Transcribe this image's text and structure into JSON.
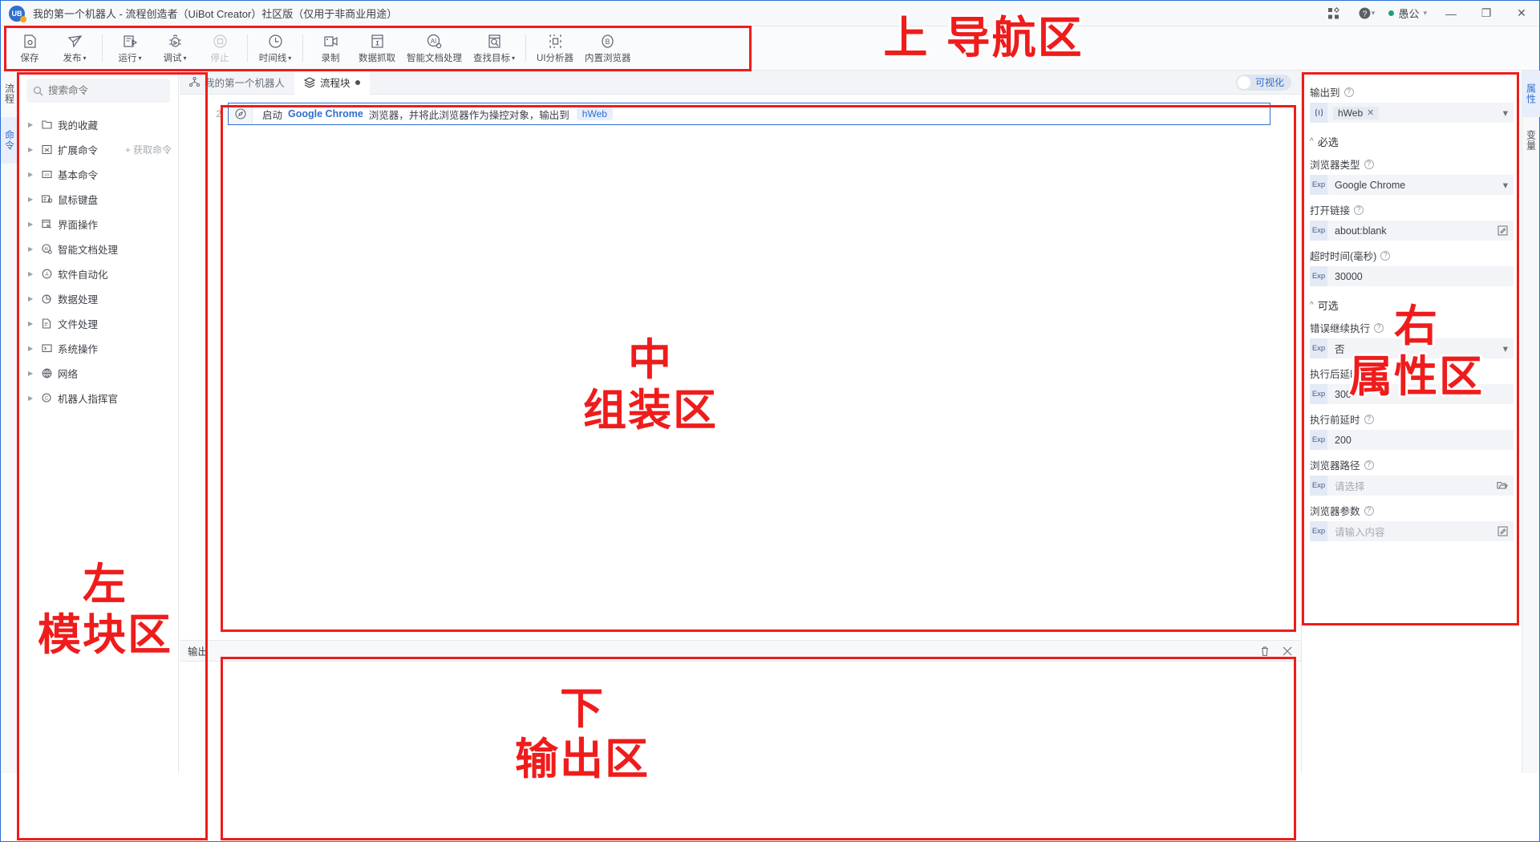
{
  "window": {
    "title": "我的第一个机器人 - 流程创造者（UiBot Creator）社区版（仅用于非商业用途）",
    "user": "愚公",
    "minimize": "—",
    "restore": "❐",
    "close": "✕"
  },
  "toolbar": {
    "groups": [
      {
        "items": [
          {
            "label": "保存",
            "icon": "save-icon",
            "caret": false,
            "disabled": false
          },
          {
            "label": "发布",
            "icon": "publish-icon",
            "caret": true,
            "disabled": false
          }
        ]
      },
      {
        "items": [
          {
            "label": "运行",
            "icon": "run-icon",
            "caret": true,
            "disabled": false
          },
          {
            "label": "调试",
            "icon": "debug-icon",
            "caret": true,
            "disabled": false
          },
          {
            "label": "停止",
            "icon": "stop-icon",
            "caret": false,
            "disabled": true
          }
        ]
      },
      {
        "items": [
          {
            "label": "时间线",
            "icon": "timeline-icon",
            "caret": true,
            "disabled": false
          }
        ]
      },
      {
        "items": [
          {
            "label": "录制",
            "icon": "record-icon",
            "caret": false,
            "disabled": false
          },
          {
            "label": "数据抓取",
            "icon": "data-scrape-icon",
            "caret": false,
            "disabled": false
          },
          {
            "label": "智能文档处理",
            "icon": "ai-doc-icon",
            "caret": false,
            "disabled": false
          },
          {
            "label": "查找目标",
            "icon": "find-target-icon",
            "caret": true,
            "disabled": false
          }
        ]
      },
      {
        "items": [
          {
            "label": "UI分析器",
            "icon": "ui-analyzer-icon",
            "caret": false,
            "disabled": false
          },
          {
            "label": "内置浏览器",
            "icon": "builtin-browser-icon",
            "caret": false,
            "disabled": false
          }
        ]
      }
    ]
  },
  "left_rail": {
    "tabs": [
      {
        "label": "流程",
        "active": false
      },
      {
        "label": "命令",
        "active": true
      }
    ]
  },
  "left_panel": {
    "search": {
      "placeholder": "搜索命令",
      "value": "",
      "icon": "search-icon"
    },
    "get_command": {
      "label": "获取命令",
      "icon": "plus-icon"
    },
    "items": [
      {
        "label": "我的收藏",
        "icon": "folder-icon"
      },
      {
        "label": "扩展命令",
        "icon": "extension-icon"
      },
      {
        "label": "基本命令",
        "icon": "basic-icon"
      },
      {
        "label": "鼠标键盘",
        "icon": "keyboard-icon"
      },
      {
        "label": "界面操作",
        "icon": "ui-operation-icon"
      },
      {
        "label": "智能文档处理",
        "icon": "ai-doc-icon"
      },
      {
        "label": "软件自动化",
        "icon": "software-automation-icon"
      },
      {
        "label": "数据处理",
        "icon": "data-process-icon"
      },
      {
        "label": "文件处理",
        "icon": "file-process-icon"
      },
      {
        "label": "系统操作",
        "icon": "system-operation-icon"
      },
      {
        "label": "网络",
        "icon": "network-icon"
      },
      {
        "label": "机器人指挥官",
        "icon": "commander-icon"
      }
    ]
  },
  "center": {
    "tabs": [
      {
        "label": "我的第一个机器人",
        "icon": "flow-icon",
        "active": false,
        "modified": false
      },
      {
        "label": "流程块",
        "icon": "blocks-icon",
        "active": true,
        "modified": true
      }
    ],
    "visualize_toggle": {
      "label": "可视化",
      "on": false
    },
    "block": {
      "line_number": "2",
      "icon": "browser-icon",
      "text_prefix": "启动",
      "highlight": "Google Chrome",
      "text_suffix": "浏览器，并将此浏览器作为操控对象，输出到",
      "output_chip": "hWeb"
    }
  },
  "output_panel": {
    "title": "输出",
    "clear_icon": "trash-icon",
    "close_icon": "close-icon",
    "content": ""
  },
  "right_rail": {
    "tabs": [
      {
        "label": "属性",
        "active": true
      },
      {
        "label": "变量",
        "active": false
      }
    ]
  },
  "right_panel": {
    "output_to": {
      "label": "输出到",
      "icon": "variable-icon",
      "value": "hWeb",
      "remove": "✕"
    },
    "sections": [
      {
        "title": "必选",
        "chevron": "^",
        "fields": [
          {
            "label": "浏览器类型",
            "prefix": "Exp",
            "value": "Google Chrome",
            "placeholder": false,
            "trailing": "chevron-down-icon"
          },
          {
            "label": "打开链接",
            "prefix": "Exp",
            "value": "about:blank",
            "placeholder": false,
            "trailing": "edit-icon"
          },
          {
            "label": "超时时间(毫秒)",
            "prefix": "Exp",
            "value": "30000",
            "placeholder": false,
            "trailing": ""
          }
        ]
      },
      {
        "title": "可选",
        "chevron": "^",
        "fields": [
          {
            "label": "错误继续执行",
            "prefix": "Exp",
            "value": "否",
            "placeholder": false,
            "trailing": "chevron-down-icon"
          },
          {
            "label": "执行后延时",
            "prefix": "Exp",
            "value": "300",
            "placeholder": false,
            "trailing": ""
          },
          {
            "label": "执行前延时",
            "prefix": "Exp",
            "value": "200",
            "placeholder": false,
            "trailing": ""
          },
          {
            "label": "浏览器路径",
            "prefix": "Exp",
            "value": "请选择",
            "placeholder": true,
            "trailing": "folder-open-icon"
          },
          {
            "label": "浏览器参数",
            "prefix": "Exp",
            "value": "请输入内容",
            "placeholder": true,
            "trailing": "edit-icon"
          }
        ]
      }
    ]
  },
  "annotations": {
    "color": "#ef1c1c",
    "labels": [
      {
        "id": "top-nav",
        "text": "上  导航区"
      },
      {
        "id": "left-module",
        "line1": "左",
        "line2": "模块区"
      },
      {
        "id": "center-assembly",
        "line1": "中",
        "line2": "组装区"
      },
      {
        "id": "right-properties",
        "line1": "右",
        "line2": "属性区"
      },
      {
        "id": "bottom-output",
        "line1": "下",
        "line2": "输出区"
      }
    ]
  }
}
